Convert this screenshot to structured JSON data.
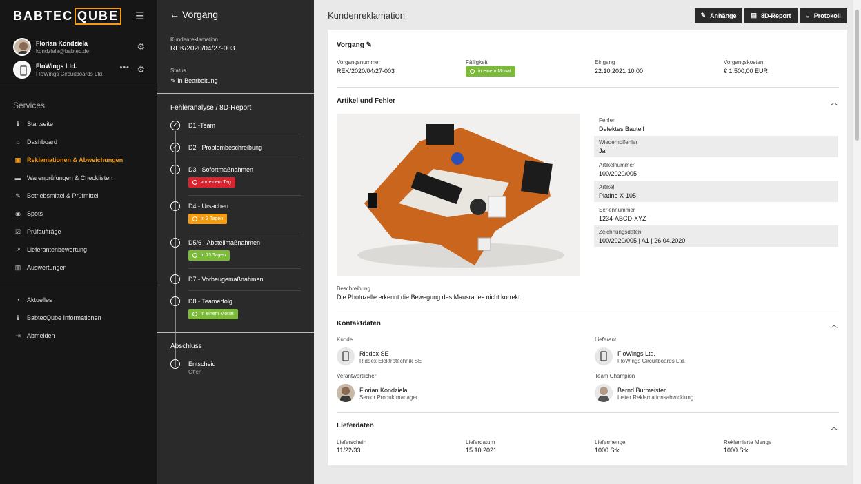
{
  "brand": {
    "pre": "BABTEC",
    "post": "QUBE"
  },
  "users": [
    {
      "name": "Florian Kondziela",
      "sub": "kondziela@babtec.de"
    },
    {
      "name": "FloWings Ltd.",
      "sub": "FloWings Circuitboards Ltd."
    }
  ],
  "sidebar": {
    "section": "Services",
    "items": [
      {
        "label": "Startseite",
        "icon": "info-icon"
      },
      {
        "label": "Dashboard",
        "icon": "home-icon"
      },
      {
        "label": "Reklamationen & Abweichungen",
        "icon": "boxes-icon",
        "active": true
      },
      {
        "label": "Warenprüfungen & Checklisten",
        "icon": "truck-icon"
      },
      {
        "label": "Betriebsmittel & Prüfmittel",
        "icon": "wrench-icon"
      },
      {
        "label": "Spots",
        "icon": "target-icon"
      },
      {
        "label": "Prüfaufträge",
        "icon": "checkbox-icon"
      },
      {
        "label": "Lieferantenbewertung",
        "icon": "trend-icon"
      },
      {
        "label": "Auswertungen",
        "icon": "bar-chart-icon"
      }
    ],
    "items2": [
      {
        "label": "Aktuelles",
        "icon": "rss-icon"
      },
      {
        "label": "BabtecQube Informationen",
        "icon": "info-icon"
      },
      {
        "label": "Abmelden",
        "icon": "logout-icon"
      }
    ]
  },
  "process": {
    "back_label": "Vorgang",
    "type_label": "Kundenreklamation",
    "id": "REK/2020/04/27-003",
    "status_label": "Status",
    "status": "In Bearbeitung",
    "steps_title": "Fehleranalyse / 8D-Report",
    "steps": [
      {
        "label": "D1 -Team",
        "done": true
      },
      {
        "label": "D2 - Problembeschreibung",
        "done": true
      },
      {
        "label": "D3 - Sofortmaßnahmen",
        "badge": "vor einem Tag",
        "badge_color": "#d9232e"
      },
      {
        "label": "D4 - Ursachen",
        "badge": "in 3 Tagen",
        "badge_color": "#f39c12"
      },
      {
        "label": "D5/6 - Abstellmaßnahmen",
        "badge": "in 13 Tagen",
        "badge_color": "#7cba3a"
      },
      {
        "label": "D7 - Vorbeugemaßnahmen"
      },
      {
        "label": "D8 - Teamerfolg",
        "badge": "in einem Monat",
        "badge_color": "#7cba3a"
      }
    ],
    "closing_title": "Abschluss",
    "closing": {
      "label": "Entscheid",
      "sub": "Offen"
    }
  },
  "header": {
    "title": "Kundenreklamation",
    "buttons": [
      {
        "label": "Anhänge",
        "icon": "paperclip-icon"
      },
      {
        "label": "8D-Report",
        "icon": "pdf-icon"
      },
      {
        "label": "Protokoll",
        "icon": "comments-icon"
      }
    ]
  },
  "vorgang": {
    "title": "Vorgang",
    "fields": [
      {
        "label": "Vorgangsnummer",
        "value": "REK/2020/04/27-003"
      },
      {
        "label": "Fälligkeit",
        "value": "in einem Monat"
      },
      {
        "label": "Eingang",
        "value": "22.10.2021 10.00"
      },
      {
        "label": "Vorgangskosten",
        "value": "€ 1.500,00 EUR"
      }
    ]
  },
  "artikel": {
    "title": "Artikel und Fehler",
    "attrs": [
      {
        "label": "Fehler",
        "value": "Defektes Bauteil"
      },
      {
        "label": "Wiederholfehler",
        "value": "Ja"
      },
      {
        "label": "Artikelnummer",
        "value": "100/2020/005"
      },
      {
        "label": "Artikel",
        "value": "Platine X-105"
      },
      {
        "label": "Seriennummer",
        "value": "1234-ABCD-XYZ"
      },
      {
        "label": "Zeichnungsdaten",
        "value": "100/2020/005 | A1 | 26.04.2020"
      }
    ],
    "desc_label": "Beschreibung",
    "desc": "Die Photozelle erkennt die Bewegung des Mausrades nicht korrekt."
  },
  "kontakt": {
    "title": "Kontaktdaten",
    "groups": [
      {
        "label": "Kunde",
        "name": "Riddex SE",
        "sub": "Riddex Elektrotechnik SE"
      },
      {
        "label": "Lieferant",
        "name": "FloWings Ltd.",
        "sub": "FloWings Circuitboards Ltd."
      },
      {
        "label": "Verantwortlicher",
        "name": "Florian Kondziela",
        "sub": "Senior Produktmanager"
      },
      {
        "label": "Team Champion",
        "name": "Bernd Burmeister",
        "sub": "Leiter Reklamationsabwicklung"
      }
    ]
  },
  "liefer": {
    "title": "Lieferdaten",
    "fields": [
      {
        "label": "Lieferschein",
        "value": "11/22/33"
      },
      {
        "label": "Lieferdatum",
        "value": "15.10.2021"
      },
      {
        "label": "Liefermenge",
        "value": "1000 Stk."
      },
      {
        "label": "Reklamierte Menge",
        "value": "1000 Stk."
      }
    ]
  }
}
